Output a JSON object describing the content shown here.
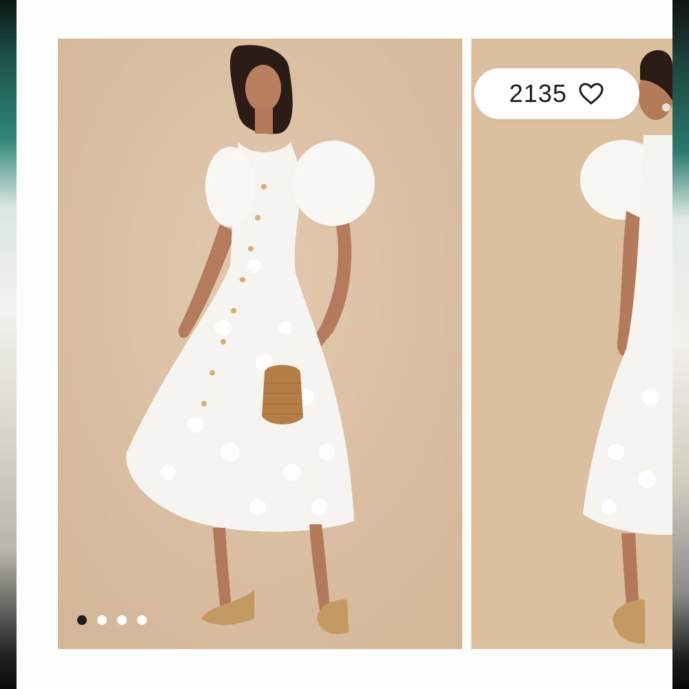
{
  "gallery": {
    "image_count": 4,
    "active_index": 0
  },
  "likes": {
    "count": "2135",
    "icon": "heart-outline-icon"
  },
  "colors": {
    "backdrop": "#dcc0a4",
    "dress": "#f7f6f3",
    "dot_active": "#1d1d1d",
    "dot_inactive": "#ffffff"
  }
}
